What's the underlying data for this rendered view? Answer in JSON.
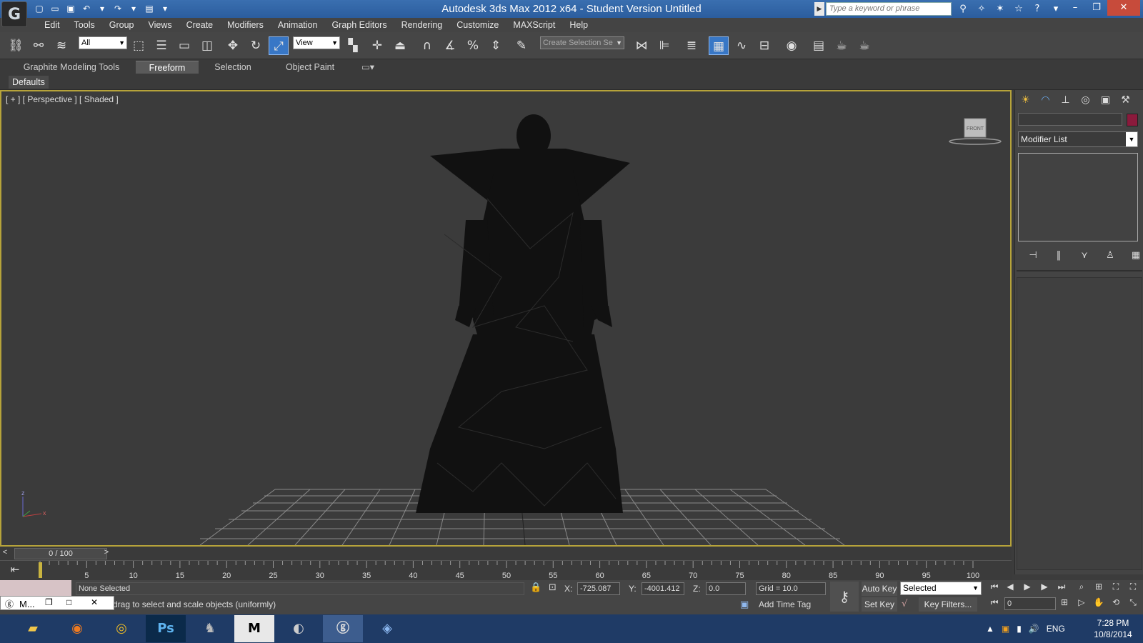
{
  "titlebar": {
    "app_name": "Autodesk 3ds Max  2012 x64  - Student Version   Untitled",
    "logo_glyph": "G",
    "search_placeholder": "Type a keyword or phrase"
  },
  "menu": {
    "items": [
      "Edit",
      "Tools",
      "Group",
      "Views",
      "Create",
      "Modifiers",
      "Animation",
      "Graph Editors",
      "Rendering",
      "Customize",
      "MAXScript",
      "Help"
    ]
  },
  "toolbar": {
    "selection_filter": "All",
    "reference_coord": "View",
    "named_selection_placeholder": "Create Selection Se"
  },
  "ribbon": {
    "tabs": [
      "Graphite Modeling Tools",
      "Freeform",
      "Selection",
      "Object Paint"
    ],
    "active_tab": "Freeform",
    "sub_label": "Defaults"
  },
  "viewport": {
    "label": "[ + ] [ Perspective ] [ Shaded ]",
    "viewcube_label": "FRONT",
    "axis_z": "z",
    "axis_y": "y",
    "axis_x": "x"
  },
  "command_panel": {
    "modifier_list": "Modifier List",
    "object_color": "#8b1a3c"
  },
  "time_slider": {
    "position": "0 / 100",
    "prev": "<",
    "next": ">"
  },
  "track_ruler": {
    "labels": [
      "5",
      "10",
      "15",
      "20",
      "25",
      "30",
      "35",
      "40",
      "45",
      "50",
      "55",
      "60",
      "65",
      "70",
      "75",
      "80",
      "85",
      "90",
      "95",
      "100"
    ]
  },
  "status": {
    "selection": "None Selected",
    "prompt": "drag to select and scale objects (uniformly)",
    "x_label": "X:",
    "x_value": "-725.087",
    "y_label": "Y:",
    "y_value": "-4001.412",
    "z_label": "Z:",
    "z_value": "0.0",
    "grid": "Grid = 10.0",
    "add_time_tag": "Add Time Tag",
    "auto_key": "Auto Key",
    "set_key": "Set Key",
    "key_mode": "Selected",
    "key_filters": "Key Filters...",
    "frame": "0",
    "task_label": "M..."
  },
  "taskbar": {
    "apps": [
      "file-explorer",
      "firefox",
      "chrome",
      "photoshop",
      "gimp",
      "mudbox",
      "media",
      "3ds-max",
      "other"
    ],
    "ps_label": "Ps",
    "m_label": "M",
    "language": "ENG",
    "time": "7:28 PM",
    "date": "10/8/2014"
  },
  "colors": {
    "accent": "#3877c6",
    "viewport_border": "#b6a33a",
    "titlebar": "#2b5d9e"
  }
}
